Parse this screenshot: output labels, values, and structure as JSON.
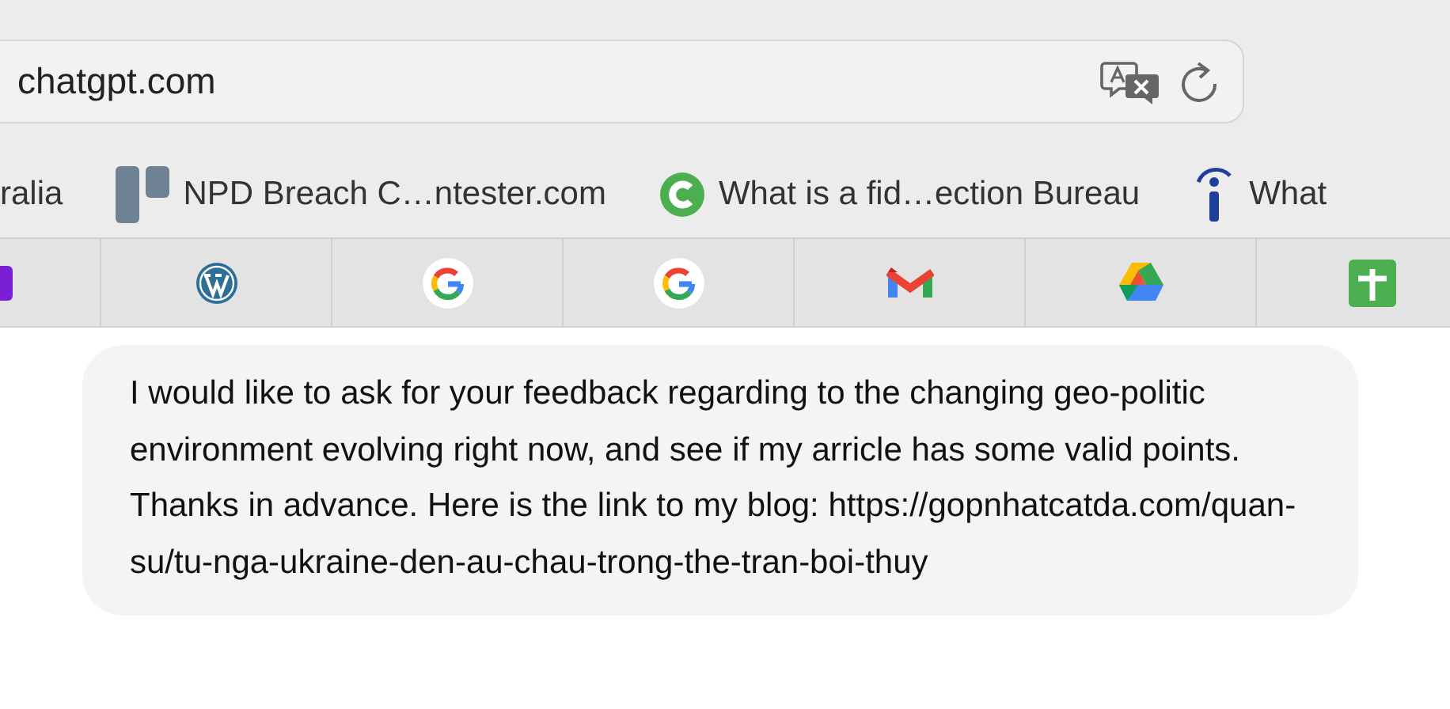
{
  "address_bar": {
    "url": "chatgpt.com"
  },
  "bookmarks": [
    {
      "kind": "none",
      "label": "ralia"
    },
    {
      "kind": "panels",
      "label": "NPD Breach C…ntester.com"
    },
    {
      "kind": "letter-c",
      "label": "What is a fid…ection Bureau"
    },
    {
      "kind": "info",
      "label": "What"
    }
  ],
  "pinned_tabs": [
    {
      "kind": "purple-square"
    },
    {
      "kind": "wordpress"
    },
    {
      "kind": "google"
    },
    {
      "kind": "google"
    },
    {
      "kind": "mail"
    },
    {
      "kind": "drive"
    },
    {
      "kind": "sheet-plus"
    }
  ],
  "message": {
    "text": "I would like to ask for your feedback regarding to the changing geo-politic environment evolving right now, and see if my arricle has some valid points.  Thanks in advance.  Here is the link to my blog: https://gopnhatcatda.com/quan-su/tu-nga-ukraine-den-au-chau-trong-the-tran-boi-thuy"
  }
}
